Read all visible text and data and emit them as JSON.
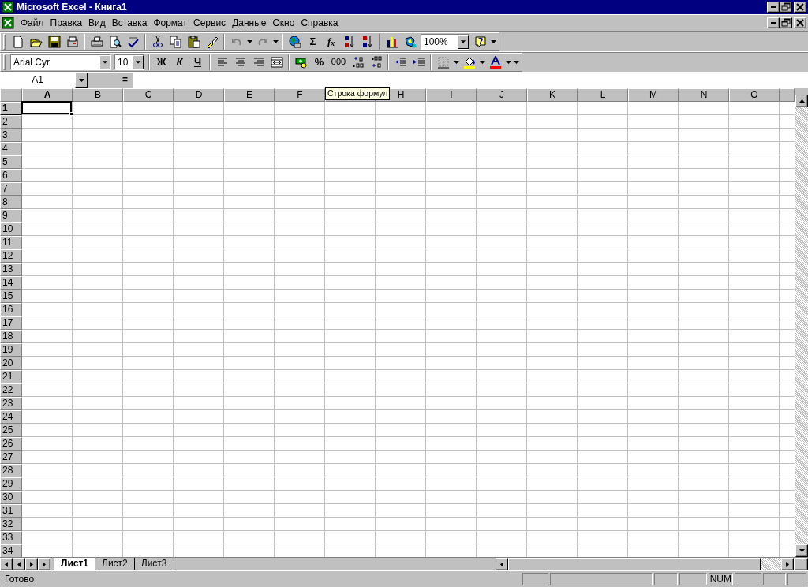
{
  "window": {
    "title": "Microsoft Excel - Книга1"
  },
  "menu": [
    {
      "label": "Файл"
    },
    {
      "label": "Правка"
    },
    {
      "label": "Вид"
    },
    {
      "label": "Вставка"
    },
    {
      "label": "Формат"
    },
    {
      "label": "Сервис"
    },
    {
      "label": "Данные"
    },
    {
      "label": "Окно"
    },
    {
      "label": "Справка"
    }
  ],
  "standard_toolbar": {
    "autosum": "Σ",
    "function": "f$_{x}$",
    "zoom": "100%"
  },
  "formatting_toolbar": {
    "font": "Arial Cyr",
    "size": "10",
    "bold": "Ж",
    "italic": "К",
    "underline": "Ч",
    "percent": "%",
    "thousands": "000"
  },
  "formula_bar": {
    "name_box": "A1",
    "equals": "="
  },
  "tooltip": "Строка формул",
  "grid": {
    "columns": [
      {
        "label": "A",
        "selected": true
      },
      {
        "label": "B",
        "selected": false
      },
      {
        "label": "C",
        "selected": false
      },
      {
        "label": "D",
        "selected": false
      },
      {
        "label": "E",
        "selected": false
      },
      {
        "label": "F",
        "selected": false
      },
      {
        "selected": false
      },
      {
        "label": "H",
        "selected": false
      },
      {
        "label": "I",
        "selected": false
      },
      {
        "label": "J",
        "selected": false
      },
      {
        "label": "K",
        "selected": false
      },
      {
        "label": "L",
        "selected": false
      },
      {
        "label": "M",
        "selected": false
      },
      {
        "label": "N",
        "selected": false
      },
      {
        "label": "O",
        "selected": false
      }
    ],
    "rows": [
      {
        "label": "1",
        "selected": true
      },
      {
        "label": "2",
        "selected": false
      },
      {
        "label": "3",
        "selected": false
      },
      {
        "label": "4",
        "selected": false
      },
      {
        "label": "5",
        "selected": false
      },
      {
        "label": "6",
        "selected": false
      },
      {
        "label": "7",
        "selected": false
      },
      {
        "label": "8",
        "selected": false
      },
      {
        "label": "9",
        "selected": false
      },
      {
        "label": "10",
        "selected": false
      },
      {
        "label": "11",
        "selected": false
      },
      {
        "label": "12",
        "selected": false
      },
      {
        "label": "13",
        "selected": false
      },
      {
        "label": "14",
        "selected": false
      },
      {
        "label": "15",
        "selected": false
      },
      {
        "label": "16",
        "selected": false
      },
      {
        "label": "17",
        "selected": false
      },
      {
        "label": "18",
        "selected": false
      },
      {
        "label": "19",
        "selected": false
      },
      {
        "label": "20",
        "selected": false
      },
      {
        "label": "21",
        "selected": false
      },
      {
        "label": "22",
        "selected": false
      },
      {
        "label": "23",
        "selected": false
      },
      {
        "label": "24",
        "selected": false
      },
      {
        "label": "25",
        "selected": false
      },
      {
        "label": "26",
        "selected": false
      },
      {
        "label": "27",
        "selected": false
      },
      {
        "label": "28",
        "selected": false
      },
      {
        "label": "29",
        "selected": false
      },
      {
        "label": "30",
        "selected": false
      },
      {
        "label": "31",
        "selected": false
      },
      {
        "label": "32",
        "selected": false
      },
      {
        "label": "33",
        "selected": false
      },
      {
        "label": "34",
        "selected": false
      }
    ]
  },
  "sheet_tabs": [
    {
      "label": "Лист1",
      "selected": true
    },
    {
      "label": "Лист2",
      "selected": false
    },
    {
      "label": "Лист3",
      "selected": false
    }
  ],
  "status_bar": {
    "text": "Готово",
    "indicators": [
      "NUM"
    ]
  }
}
